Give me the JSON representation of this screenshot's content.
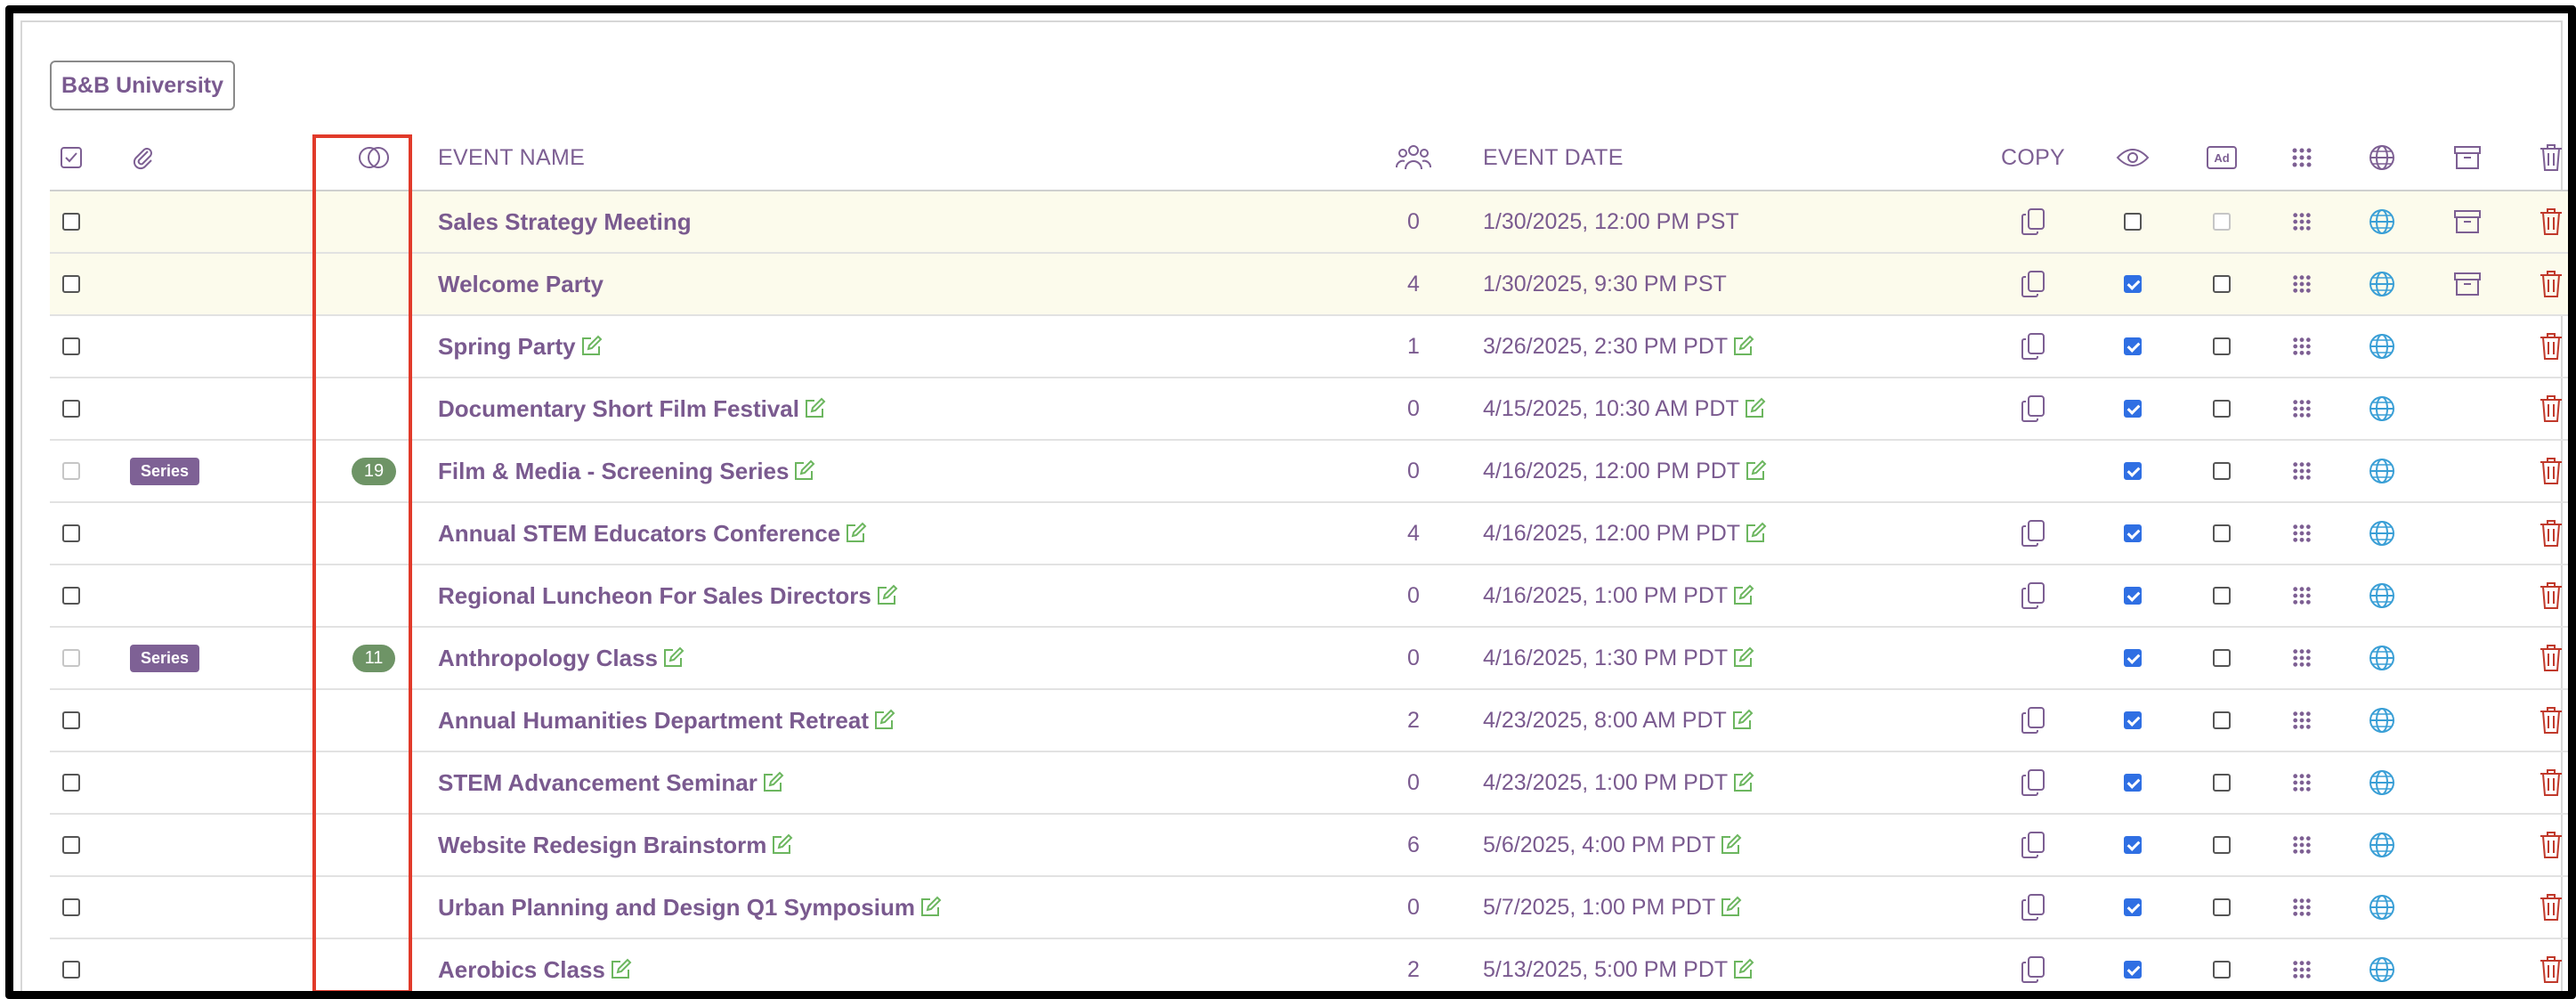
{
  "org_button": "B&B University",
  "header": {
    "event_name": "EVENT NAME",
    "event_date": "EVENT DATE",
    "copy": "COPY",
    "icons": [
      "select-all-icon",
      "attachment-icon",
      "linked-events-icon",
      "attendees-icon",
      "visibility-icon",
      "ad-icon",
      "grid-icon",
      "globe-icon",
      "archive-icon",
      "trash-icon"
    ]
  },
  "colors": {
    "accent": "#7a5a8f",
    "highlight": "#e13a2a",
    "check": "#2f6fe3",
    "series": "#7e6195",
    "count": "#6e9466",
    "edit": "#6cb65f",
    "globe": "#3a9fd6",
    "trash": "#c0392b"
  },
  "rows": [
    {
      "name": "Sales Strategy Meeting",
      "attendees": "0",
      "date": "1/30/2025, 12:00 PM PST",
      "editable": false,
      "copy": true,
      "visible": false,
      "ad": "disabled",
      "archive": true,
      "series": "",
      "linked": "",
      "highlight": true,
      "select": "enabled"
    },
    {
      "name": "Welcome Party",
      "attendees": "4",
      "date": "1/30/2025, 9:30 PM PST",
      "editable": false,
      "copy": true,
      "visible": true,
      "ad": "unchecked",
      "archive": true,
      "series": "",
      "linked": "",
      "highlight": true,
      "select": "enabled"
    },
    {
      "name": "Spring Party",
      "attendees": "1",
      "date": "3/26/2025, 2:30 PM PDT",
      "editable": true,
      "copy": true,
      "visible": true,
      "ad": "unchecked",
      "archive": false,
      "series": "",
      "linked": "",
      "highlight": false,
      "select": "enabled"
    },
    {
      "name": "Documentary Short Film Festival",
      "attendees": "0",
      "date": "4/15/2025, 10:30 AM PDT",
      "editable": true,
      "copy": true,
      "visible": true,
      "ad": "unchecked",
      "archive": false,
      "series": "",
      "linked": "",
      "highlight": false,
      "select": "enabled"
    },
    {
      "name": "Film & Media - Screening Series",
      "attendees": "0",
      "date": "4/16/2025, 12:00 PM PDT",
      "editable": true,
      "copy": false,
      "visible": true,
      "ad": "unchecked",
      "archive": false,
      "series": "Series",
      "linked": "19",
      "highlight": false,
      "select": "disabled"
    },
    {
      "name": "Annual STEM Educators Conference",
      "attendees": "4",
      "date": "4/16/2025, 12:00 PM PDT",
      "editable": true,
      "copy": true,
      "visible": true,
      "ad": "unchecked",
      "archive": false,
      "series": "",
      "linked": "",
      "highlight": false,
      "select": "enabled"
    },
    {
      "name": "Regional Luncheon For Sales Directors",
      "attendees": "0",
      "date": "4/16/2025, 1:00 PM PDT",
      "editable": true,
      "copy": true,
      "visible": true,
      "ad": "unchecked",
      "archive": false,
      "series": "",
      "linked": "",
      "highlight": false,
      "select": "enabled"
    },
    {
      "name": "Anthropology Class",
      "attendees": "0",
      "date": "4/16/2025, 1:30 PM PDT",
      "editable": true,
      "copy": false,
      "visible": true,
      "ad": "unchecked",
      "archive": false,
      "series": "Series",
      "linked": "11",
      "highlight": false,
      "select": "disabled"
    },
    {
      "name": "Annual Humanities Department Retreat",
      "attendees": "2",
      "date": "4/23/2025, 8:00 AM PDT",
      "editable": true,
      "copy": true,
      "visible": true,
      "ad": "unchecked",
      "archive": false,
      "series": "",
      "linked": "",
      "highlight": false,
      "select": "enabled"
    },
    {
      "name": "STEM Advancement Seminar",
      "attendees": "0",
      "date": "4/23/2025, 1:00 PM PDT",
      "editable": true,
      "copy": true,
      "visible": true,
      "ad": "unchecked",
      "archive": false,
      "series": "",
      "linked": "",
      "highlight": false,
      "select": "enabled"
    },
    {
      "name": "Website Redesign Brainstorm",
      "attendees": "6",
      "date": "5/6/2025, 4:00 PM PDT",
      "editable": true,
      "copy": true,
      "visible": true,
      "ad": "unchecked",
      "archive": false,
      "series": "",
      "linked": "",
      "highlight": false,
      "select": "enabled"
    },
    {
      "name": "Urban Planning and Design Q1 Symposium",
      "attendees": "0",
      "date": "5/7/2025, 1:00 PM PDT",
      "editable": true,
      "copy": true,
      "visible": true,
      "ad": "unchecked",
      "archive": false,
      "series": "",
      "linked": "",
      "highlight": false,
      "select": "enabled"
    },
    {
      "name": "Aerobics Class",
      "attendees": "2",
      "date": "5/13/2025, 5:00 PM PDT",
      "editable": true,
      "copy": true,
      "visible": true,
      "ad": "unchecked",
      "archive": false,
      "series": "",
      "linked": "",
      "highlight": false,
      "select": "enabled"
    }
  ]
}
